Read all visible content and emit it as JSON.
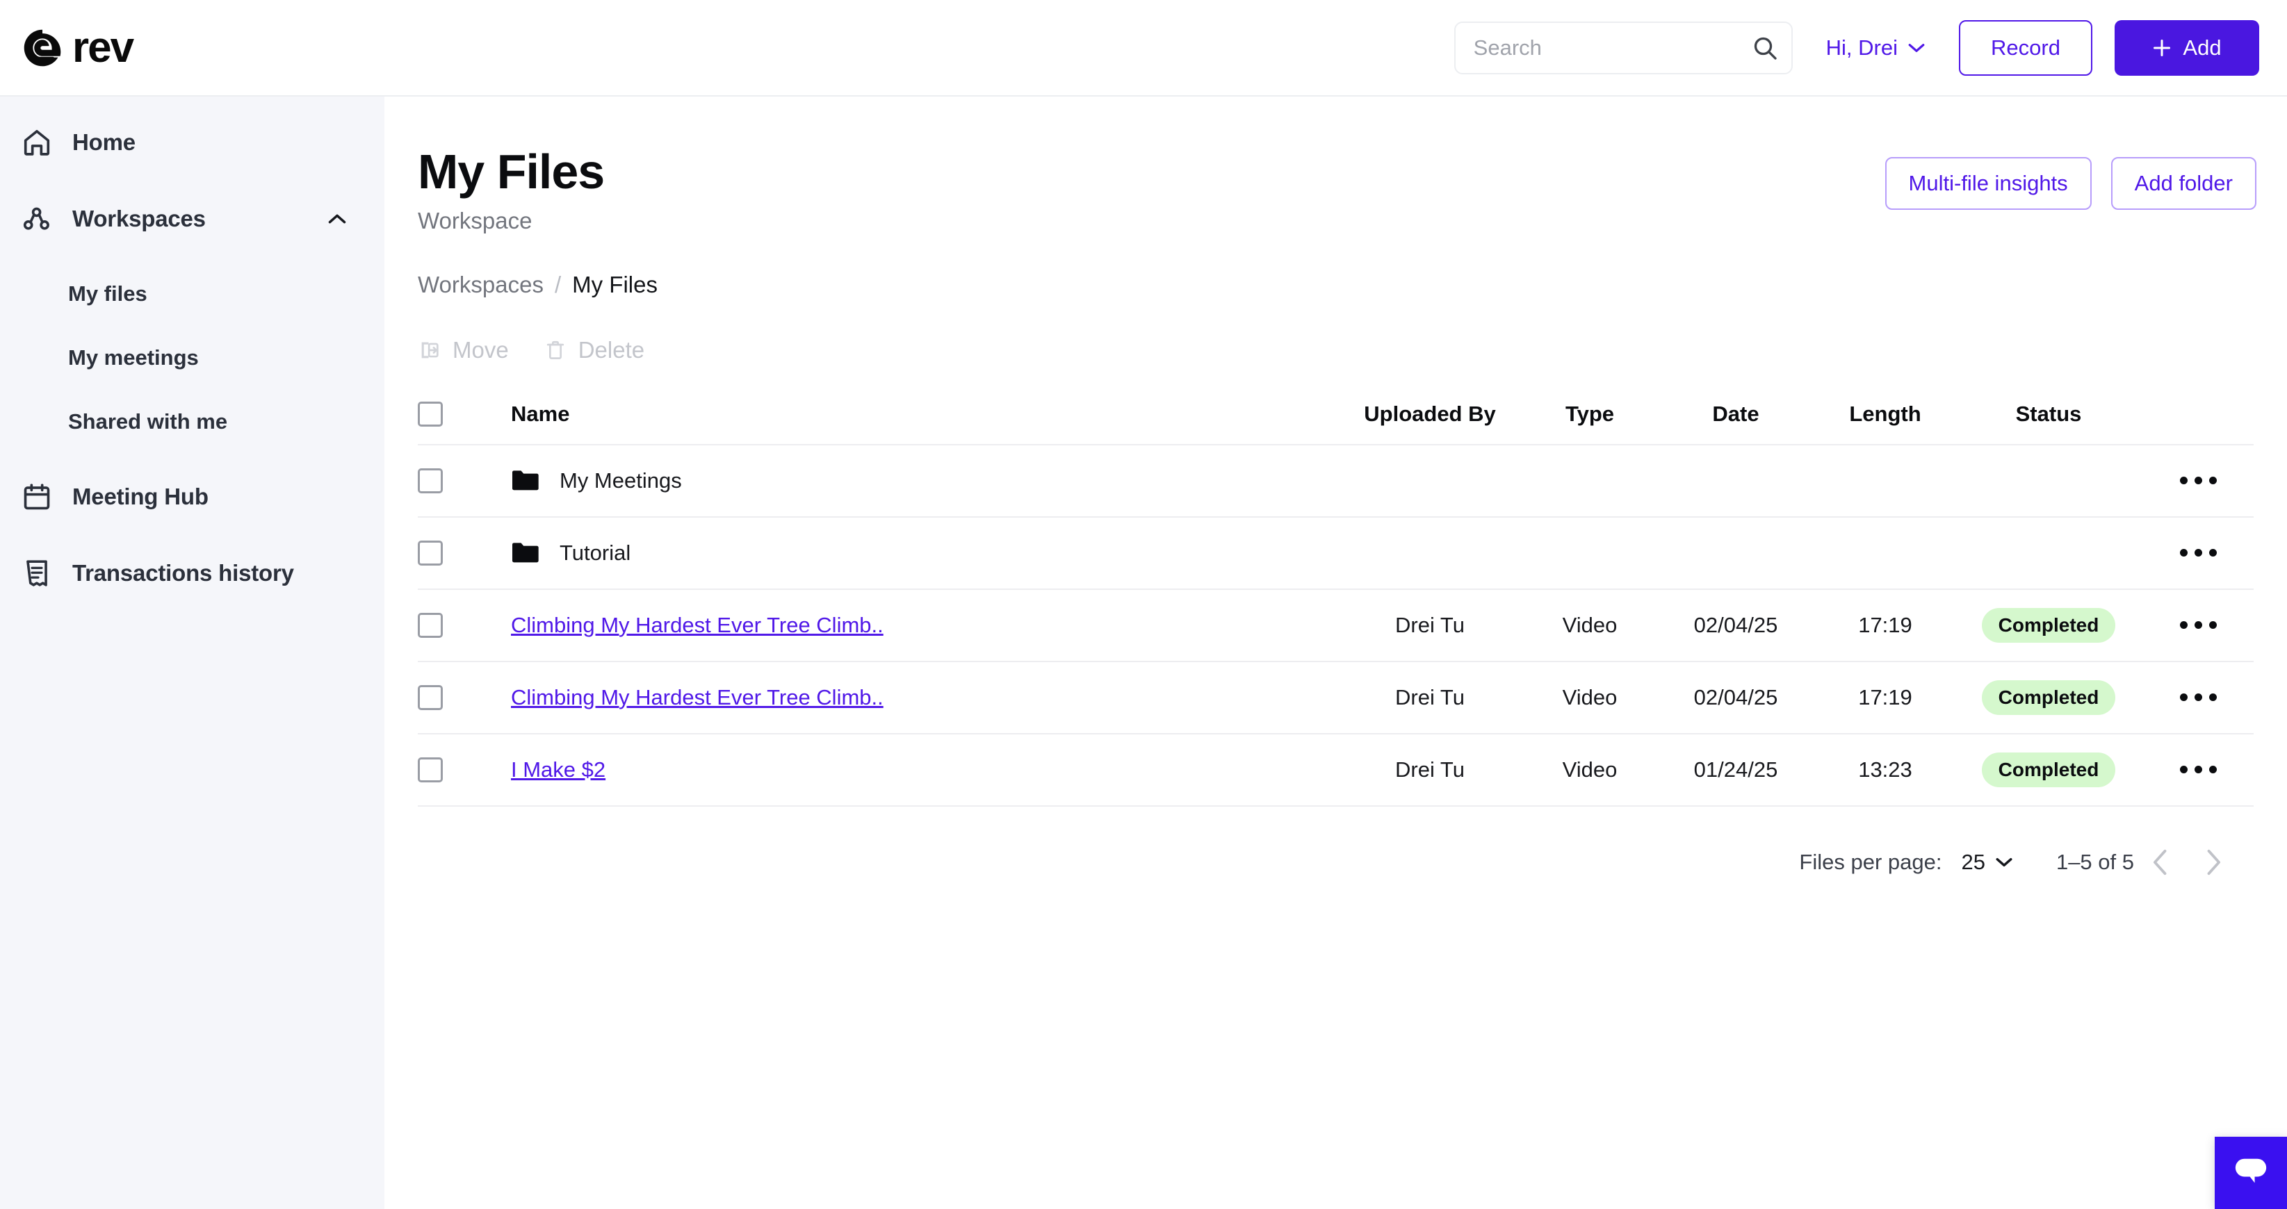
{
  "brand": {
    "name": "rev",
    "logo_icon": "rev-logo-icon",
    "accent": "#5018e8",
    "accent_solid": "#4a17e0"
  },
  "topbar": {
    "search": {
      "value": "",
      "placeholder": "Search",
      "icon": "search-icon"
    },
    "user_menu": {
      "label": "Hi, Drei",
      "icon": "chevron-down-icon"
    },
    "record_button": "Record",
    "add_button": "Add",
    "add_icon": "plus-icon"
  },
  "sidebar": {
    "items": [
      {
        "label": "Home",
        "icon": "home-icon"
      },
      {
        "label": "Workspaces",
        "icon": "workspaces-icon",
        "caret": "chevron-up-icon",
        "expanded": true
      },
      {
        "label": "Meeting Hub",
        "icon": "calendar-icon"
      },
      {
        "label": "Transactions history",
        "icon": "receipt-icon"
      }
    ],
    "sub_items": [
      {
        "label": "My files"
      },
      {
        "label": "My meetings"
      },
      {
        "label": "Shared with me"
      }
    ]
  },
  "page": {
    "title": "My Files",
    "subtitle": "Workspace",
    "actions": {
      "multi_file_insights": "Multi-file insights",
      "add_folder": "Add folder"
    },
    "breadcrumb": {
      "parent": "Workspaces",
      "separator": "/",
      "current": "My Files"
    }
  },
  "bulk_actions": {
    "move": {
      "label": "Move",
      "icon": "move-icon",
      "disabled": true
    },
    "delete": {
      "label": "Delete",
      "icon": "trash-icon",
      "disabled": true
    }
  },
  "table": {
    "columns": [
      "Name",
      "Uploaded By",
      "Type",
      "Date",
      "Length",
      "Status"
    ],
    "select_all_checkbox": false,
    "rows": [
      {
        "kind": "folder",
        "icon": "folder-icon",
        "name": "My Meetings",
        "uploaded_by": "",
        "type": "",
        "date": "",
        "length": "",
        "status": "",
        "menu_icon": "kebab-menu-icon"
      },
      {
        "kind": "folder",
        "icon": "folder-icon",
        "name": "Tutorial",
        "uploaded_by": "",
        "type": "",
        "date": "",
        "length": "",
        "status": "",
        "menu_icon": "kebab-menu-icon"
      },
      {
        "kind": "file",
        "icon": "",
        "name": "Climbing My Hardest Ever Tree Climb..",
        "uploaded_by": "Drei Tu",
        "type": "Video",
        "date": "02/04/25",
        "length": "17:19",
        "status": "Completed",
        "menu_icon": "kebab-menu-icon"
      },
      {
        "kind": "file",
        "icon": "",
        "name": "Climbing My Hardest Ever Tree Climb..",
        "uploaded_by": "Drei Tu",
        "type": "Video",
        "date": "02/04/25",
        "length": "17:19",
        "status": "Completed",
        "menu_icon": "kebab-menu-icon"
      },
      {
        "kind": "file",
        "icon": "",
        "name": "I Make $2",
        "uploaded_by": "Drei Tu",
        "type": "Video",
        "date": "01/24/25",
        "length": "13:23",
        "status": "Completed",
        "menu_icon": "kebab-menu-icon"
      }
    ],
    "status_badge_color": "#d5f8cd"
  },
  "pagination": {
    "label": "Files per page:",
    "page_size": "25",
    "page_size_icon": "chevron-down-icon",
    "range": "1–5 of 5",
    "prev_icon": "chevron-left-icon",
    "next_icon": "chevron-right-icon"
  },
  "chat": {
    "icon": "chat-bubble-icon",
    "color": "#3a10f0"
  }
}
